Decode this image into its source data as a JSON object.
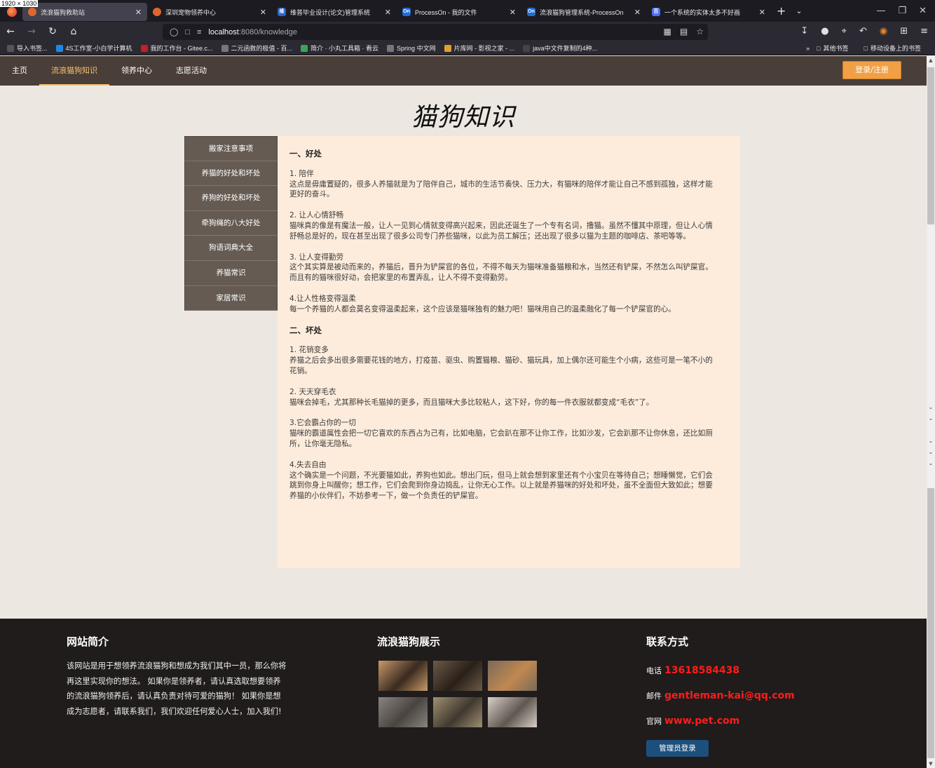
{
  "overlay": {
    "dimensions": "1920 × 1030"
  },
  "browser": {
    "tabs": [
      {
        "label": "流浪猫狗救助站",
        "color": "#e0662f",
        "glyph": ""
      },
      {
        "label": "深圳宠物领养中心",
        "color": "#e0662f",
        "glyph": ""
      },
      {
        "label": "维普毕业设计(论文)管理系统",
        "color": "#2a62c9",
        "glyph": "维"
      },
      {
        "label": "ProcessOn - 我的文件",
        "color": "#1e6cd4",
        "glyph": "On"
      },
      {
        "label": "流浪猫狗管理系统-ProcessOn",
        "color": "#1e6cd4",
        "glyph": "On"
      },
      {
        "label": "一个系统的实体太多不好画",
        "color": "#4e6ef2",
        "glyph": "百"
      }
    ],
    "url_host": "localhost",
    "url_path": ":8080/knowledge",
    "bookmarks": [
      {
        "label": "导入书签...",
        "color": "#555"
      },
      {
        "label": "4S工作室-小白学计算机",
        "color": "#1e88e5"
      },
      {
        "label": "我的工作台 - Gitee.c...",
        "color": "#c71d23"
      },
      {
        "label": "二元函数的极值 - 百...",
        "color": "#777"
      },
      {
        "label": "简介 · 小丸工具箱 · 看云",
        "color": "#3aa45a"
      },
      {
        "label": "Spring 中文网",
        "color": "#777"
      },
      {
        "label": "片库网 - 影视之家 - ...",
        "color": "#e0a030"
      },
      {
        "label": "java中文件复制的4种...",
        "color": "#444"
      }
    ],
    "bookmarks_other": "其他书签",
    "bookmarks_mobile": "移动设备上的书签"
  },
  "site": {
    "nav": [
      {
        "label": "主页",
        "active": false
      },
      {
        "label": "流浪猫狗知识",
        "active": true
      },
      {
        "label": "领养中心",
        "active": false
      },
      {
        "label": "志愿活动",
        "active": false
      }
    ],
    "login_label": "登录/注册",
    "page_title": "猫狗知识",
    "side_menu": [
      "搬家注意事项",
      "养猫的好处和坏处",
      "养狗的好处和坏处",
      "牵狗绳的八大好处",
      "狗语词典大全",
      "养猫常识",
      "家居常识"
    ],
    "article": {
      "h1": "一、好处",
      "good": [
        {
          "title": "1. 陪伴",
          "body": "这点是毋庸置疑的，很多人养猫就是为了陪伴自己，城市的生活节奏快、压力大，有猫咪的陪伴才能让自己不感到孤独，这样才能更好的奋斗。"
        },
        {
          "title": "2. 让人心情舒畅",
          "body": "猫咪真的像是有魔法一般，让人一见到心情就变得高兴起来，因此还诞生了一个专有名词，撸猫。虽然不懂其中原理，但让人心情舒畅总是好的，现在甚至出现了很多公司专门养些猫咪，以此为员工解压；还出现了很多以猫为主题的咖啡店、茶吧等等。"
        },
        {
          "title": "3. 让人变得勤劳",
          "body": "这个其实算是被动而来的，养猫后，晋升为铲屎官的各位，不得不每天为猫咪准备猫粮和水，当然还有铲屎，不然怎么叫铲屎官。而且有的猫咪很好动，会把家里的布置弄乱，让人不得不变得勤劳。"
        },
        {
          "title": "4.让人性格变得温柔",
          "body": "每一个养猫的人都会莫名变得温柔起来，这个应该是猫咪独有的魅力吧！猫咪用自己的温柔融化了每一个铲屎官的心。"
        }
      ],
      "h2": "二、坏处",
      "bad": [
        {
          "title": "1. 花销变多",
          "body": "养猫之后会多出很多需要花钱的地方，打疫苗、驱虫、购置猫粮、猫砂、猫玩具，加上偶尔还可能生个小病，这些可是一笔不小的花销。"
        },
        {
          "title": "2. 天天穿毛衣",
          "body": "猫咪会掉毛，尤其那种长毛猫掉的更多，而且猫咪大多比较粘人，这下好，你的每一件衣服就都变成“毛衣”了。"
        },
        {
          "title": "3.它会霸占你的一切",
          "body": "猫咪的霸道属性会把一切它喜欢的东西占为己有，比如电脑，它会趴在那不让你工作，比如沙发，它会趴那不让你休息，还比如厕所，让你毫无隐私。"
        },
        {
          "title": "4.失去自由",
          "body": "这个确实是一个问题，不光要猫如此，养狗也如此。想出门玩，但马上就会想到家里还有个小宝贝在等待自己；想睡懒觉，它们会跳到你身上叫醒你；想工作，它们会爬到你身边捣乱，让你无心工作。以上就是养猫咪的好处和坏处，虽不全面但大致如此；想要养猫的小伙伴们，不妨参考一下，做一个负责任的铲屎官。"
        }
      ]
    }
  },
  "footer": {
    "intro_title": "网站简介",
    "intro_text": "该网站是用于想领养流浪猫狗和想成为我们其中一员，那么你将再这里实现你的想法。 如果你是领养者，请认真选取想要领养的流浪猫狗领养后，请认真负责对待可爱的猫狗！ 如果你是想成为志愿者，请联系我们，我们欢迎任何爱心人士，加入我们!",
    "gallery_title": "流浪猫狗展示",
    "gallery": [
      {
        "c1": "#c89a6a",
        "c2": "#3a2a20"
      },
      {
        "c1": "#6b5a48",
        "c2": "#2a2018"
      },
      {
        "c1": "#7a6a5a",
        "c2": "#c08850"
      },
      {
        "c1": "#8a8480",
        "c2": "#4a4440"
      },
      {
        "c1": "#a09070",
        "c2": "#403830"
      },
      {
        "c1": "#d8d0c8",
        "c2": "#605850"
      }
    ],
    "contact_title": "联系方式",
    "phone_label": "电话",
    "phone": "13618584438",
    "email_label": "邮件",
    "email": "gentleman-kai@qq.com",
    "site_label": "官网",
    "site": "www.pet.com",
    "admin_label": "管理员登录"
  }
}
